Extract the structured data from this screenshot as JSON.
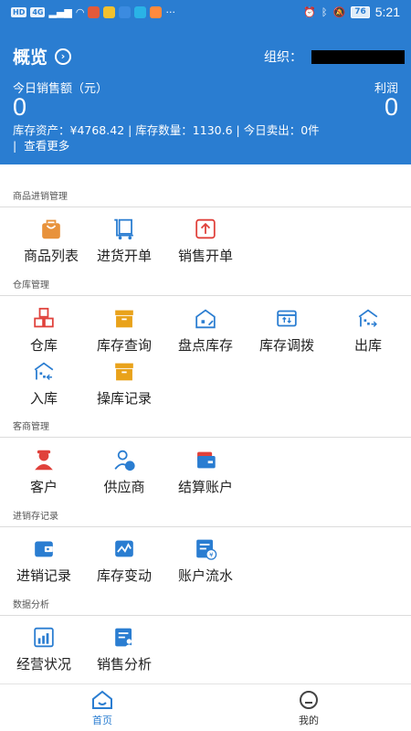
{
  "status_bar": {
    "left_chips": [
      "HD",
      "4G"
    ],
    "right_battery": "76",
    "time": "5:21",
    "ellipsis": "···"
  },
  "header": {
    "title": "概览",
    "org_label": "组织：",
    "sales_label": "今日销售额（元）",
    "sales_value": "0",
    "profit_label": "利润",
    "profit_value": "0",
    "stats_line": "库存资产：¥4768.42 | 库存数量：1130.6 | 今日卖出：0件",
    "more_bar": "|",
    "more_label": "查看更多"
  },
  "sections": {
    "goods": {
      "title": "商品进销管理",
      "items": [
        "商品列表",
        "进货开单",
        "销售开单"
      ]
    },
    "warehouse": {
      "title": "仓库管理",
      "items": [
        "仓库",
        "库存查询",
        "盘点库存",
        "库存调拨",
        "出库",
        "入库",
        "操库记录"
      ]
    },
    "customers": {
      "title": "客商管理",
      "items": [
        "客户",
        "供应商",
        "结算账户"
      ]
    },
    "records": {
      "title": "进销存记录",
      "items": [
        "进销记录",
        "库存变动",
        "账户流水"
      ]
    },
    "analysis": {
      "title": "数据分析",
      "items": [
        "经营状况",
        "销售分析"
      ]
    }
  },
  "bottom_nav": {
    "tabs": [
      "首页",
      "我的"
    ],
    "active_color": "#2a7dd1"
  },
  "colors": {
    "primary": "#2a7dd1",
    "orange": "#e8923b",
    "gold": "#e9a21a",
    "red": "#e0413b"
  }
}
